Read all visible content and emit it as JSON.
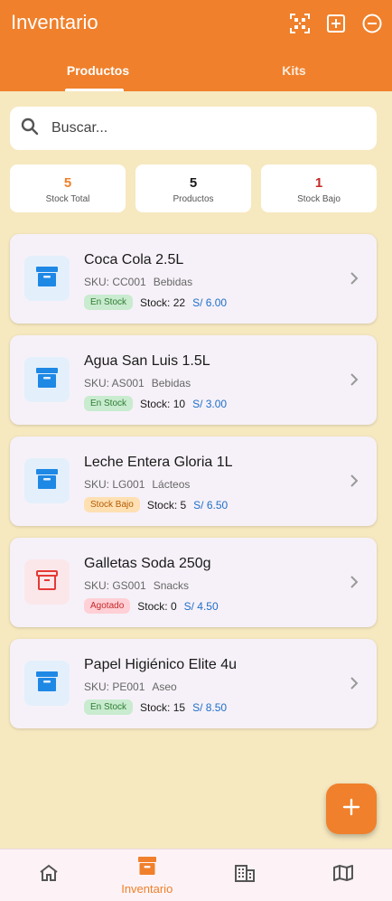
{
  "app": {
    "title": "Inventario"
  },
  "header_actions": [
    {
      "icon": "qr-code-icon"
    },
    {
      "icon": "add-box-icon"
    },
    {
      "icon": "remove-circle-icon"
    }
  ],
  "tabs": [
    {
      "label": "Productos",
      "active": true
    },
    {
      "label": "Kits",
      "active": false
    }
  ],
  "search": {
    "placeholder": "Buscar...",
    "value": ""
  },
  "stats": [
    {
      "value": "5",
      "label": "Stock Total",
      "color": "#f0802b"
    },
    {
      "value": "5",
      "label": "Productos",
      "color": "#1a1a1a"
    },
    {
      "value": "1",
      "label": "Stock Bajo",
      "color": "#c62828"
    }
  ],
  "products": [
    {
      "name": "Coca Cola 2.5L",
      "sku": "SKU: CC001",
      "category": "Bebidas",
      "status": "En Stock",
      "status_kind": "ok",
      "stock": "Stock: 22",
      "price": "S/ 6.00",
      "icon_color": "#1e88e5"
    },
    {
      "name": "Agua San Luis 1.5L",
      "sku": "SKU: AS001",
      "category": "Bebidas",
      "status": "En Stock",
      "status_kind": "ok",
      "stock": "Stock: 10",
      "price": "S/ 3.00",
      "icon_color": "#1e88e5"
    },
    {
      "name": "Leche Entera Gloria 1L",
      "sku": "SKU: LG001",
      "category": "Lácteos",
      "status": "Stock Bajo",
      "status_kind": "low",
      "stock": "Stock: 5",
      "price": "S/ 6.50",
      "icon_color": "#1e88e5"
    },
    {
      "name": "Galletas Soda 250g",
      "sku": "SKU: GS001",
      "category": "Snacks",
      "status": "Agotado",
      "status_kind": "out",
      "stock": "Stock: 0",
      "price": "S/ 4.50",
      "icon_color": "#e53935"
    },
    {
      "name": "Papel Higiénico Elite 4u",
      "sku": "SKU: PE001",
      "category": "Aseo",
      "status": "En Stock",
      "status_kind": "ok",
      "stock": "Stock: 15",
      "price": "S/ 8.50",
      "icon_color": "#1e88e5"
    }
  ],
  "bottom_nav": [
    {
      "icon": "home-icon",
      "label": ""
    },
    {
      "icon": "inventory-icon",
      "label": "Inventario",
      "active": true
    },
    {
      "icon": "building-icon",
      "label": ""
    },
    {
      "icon": "map-icon",
      "label": ""
    }
  ],
  "colors": {
    "brand": "#f0802b",
    "background": "#f6e8bf",
    "price": "#1e6fc8"
  }
}
